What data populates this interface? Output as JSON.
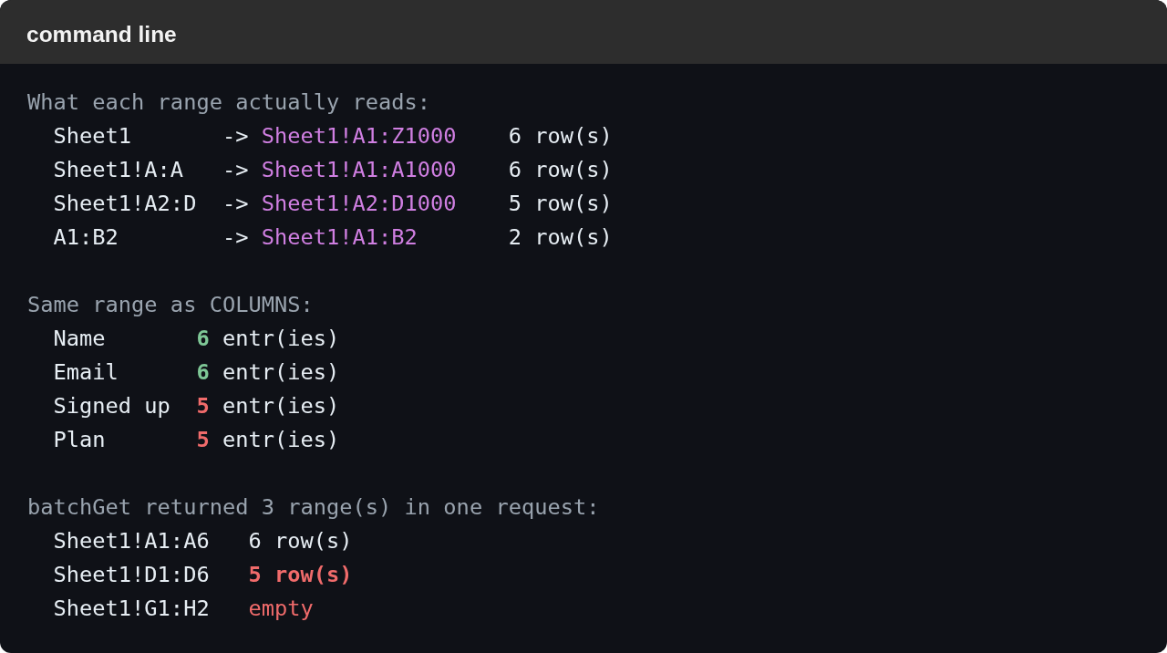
{
  "window": {
    "title": "command line"
  },
  "sections": [
    {
      "kind": "mapping",
      "heading": "What each range actually reads:",
      "rows": [
        {
          "range": "Sheet1",
          "arrow": "->",
          "resolved": "Sheet1!A1:Z1000",
          "count": "6 row(s)"
        },
        {
          "range": "Sheet1!A:A",
          "arrow": "->",
          "resolved": "Sheet1!A1:A1000",
          "count": "6 row(s)"
        },
        {
          "range": "Sheet1!A2:D",
          "arrow": "->",
          "resolved": "Sheet1!A2:D1000",
          "count": "5 row(s)"
        },
        {
          "range": "A1:B2",
          "arrow": "->",
          "resolved": "Sheet1!A1:B2",
          "count": "2 row(s)"
        }
      ]
    },
    {
      "kind": "columns",
      "heading": "Same range as COLUMNS:",
      "rows": [
        {
          "name": "Name",
          "count": "6",
          "unit": "entr(ies)",
          "color": "#7ec796"
        },
        {
          "name": "Email",
          "count": "6",
          "unit": "entr(ies)",
          "color": "#7ec796"
        },
        {
          "name": "Signed up",
          "count": "5",
          "unit": "entr(ies)",
          "color": "#f06b6b"
        },
        {
          "name": "Plan",
          "count": "5",
          "unit": "entr(ies)",
          "color": "#f06b6b"
        }
      ]
    },
    {
      "kind": "batch",
      "heading": "batchGet returned 3 range(s) in one request:",
      "rows": [
        {
          "range": "Sheet1!A1:A6",
          "result": "6 row(s)",
          "color": "#e6edf3",
          "emphasized": false
        },
        {
          "range": "Sheet1!D1:D6",
          "result": "5 row(s)",
          "color": "#f06b6b",
          "emphasized": true
        },
        {
          "range": "Sheet1!G1:H2",
          "result": "empty",
          "color": "#f06b6b",
          "emphasized": false
        }
      ]
    }
  ]
}
